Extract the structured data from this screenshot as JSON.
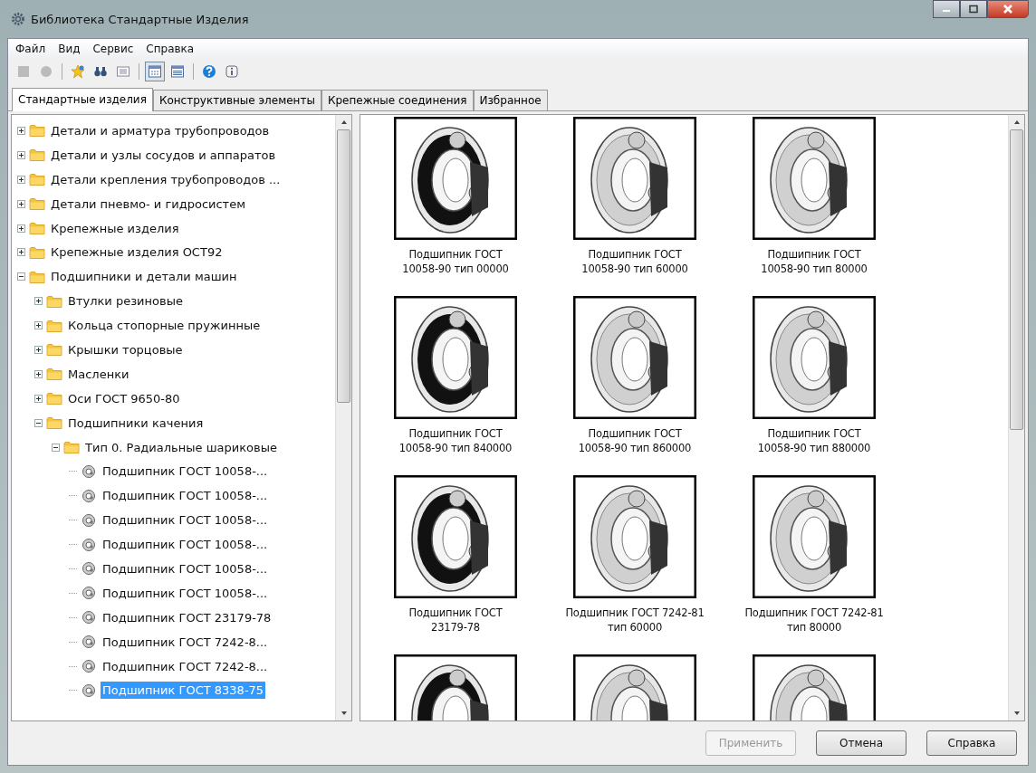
{
  "window": {
    "title": "Библиотека Стандартные Изделия"
  },
  "menu": [
    "Файл",
    "Вид",
    "Сервис",
    "Справка"
  ],
  "toolbar": [
    {
      "kind": "page",
      "disabled": true,
      "selected": false
    },
    {
      "kind": "circle",
      "disabled": true,
      "selected": false
    },
    {
      "kind": "star",
      "disabled": false,
      "selected": false
    },
    {
      "kind": "binoculars",
      "disabled": false,
      "selected": false
    },
    {
      "kind": "list",
      "disabled": false,
      "selected": false
    },
    {
      "kind": "grid",
      "disabled": false,
      "selected": true
    },
    {
      "kind": "table",
      "disabled": false,
      "selected": false
    },
    {
      "kind": "help",
      "disabled": false,
      "selected": false
    },
    {
      "kind": "info",
      "disabled": false,
      "selected": false
    }
  ],
  "tabs": [
    {
      "label": "Стандартные изделия",
      "selected": true
    },
    {
      "label": "Конструктивные элементы",
      "selected": false
    },
    {
      "label": "Крепежные соединения",
      "selected": false
    },
    {
      "label": "Избранное",
      "selected": false
    }
  ],
  "tree": [
    {
      "label": "Детали и арматура трубопроводов",
      "kind": "folder",
      "expanded": false,
      "selected": false
    },
    {
      "label": "Детали и узлы сосудов и аппаратов",
      "kind": "folder",
      "expanded": false,
      "selected": false
    },
    {
      "label": "Детали крепления трубопроводов ...",
      "kind": "folder",
      "expanded": false,
      "selected": false
    },
    {
      "label": "Детали пневмо- и гидросистем",
      "kind": "folder",
      "expanded": false,
      "selected": false
    },
    {
      "label": "Крепежные изделия",
      "kind": "folder",
      "expanded": false,
      "selected": false
    },
    {
      "label": "Крепежные изделия ОСТ92",
      "kind": "folder",
      "expanded": false,
      "selected": false
    },
    {
      "label": "Подшипники и детали машин",
      "kind": "folder",
      "expanded": true,
      "selected": false,
      "children": [
        {
          "label": "Втулки резиновые",
          "kind": "folder",
          "expanded": false,
          "selected": false
        },
        {
          "label": "Кольца стопорные пружинные",
          "kind": "folder",
          "expanded": false,
          "selected": false
        },
        {
          "label": "Крышки торцовые",
          "kind": "folder",
          "expanded": false,
          "selected": false
        },
        {
          "label": "Масленки",
          "kind": "folder",
          "expanded": false,
          "selected": false
        },
        {
          "label": "Оси ГОСТ 9650-80",
          "kind": "folder",
          "expanded": false,
          "selected": false
        },
        {
          "label": "Подшипники качения",
          "kind": "folder",
          "expanded": true,
          "selected": false,
          "children": [
            {
              "label": "Тип 0. Радиальные шариковые",
              "kind": "folder",
              "expanded": true,
              "selected": false,
              "children": [
                {
                  "label": "Подшипник ГОСТ 10058-...",
                  "kind": "item",
                  "selected": false
                },
                {
                  "label": "Подшипник ГОСТ 10058-...",
                  "kind": "item",
                  "selected": false
                },
                {
                  "label": "Подшипник ГОСТ 10058-...",
                  "kind": "item",
                  "selected": false
                },
                {
                  "label": "Подшипник ГОСТ 10058-...",
                  "kind": "item",
                  "selected": false
                },
                {
                  "label": "Подшипник ГОСТ 10058-...",
                  "kind": "item",
                  "selected": false
                },
                {
                  "label": "Подшипник ГОСТ 10058-...",
                  "kind": "item",
                  "selected": false
                },
                {
                  "label": "Подшипник ГОСТ 23179-78",
                  "kind": "item",
                  "selected": false
                },
                {
                  "label": "Подшипник ГОСТ 7242-8...",
                  "kind": "item",
                  "selected": false
                },
                {
                  "label": "Подшипник ГОСТ 7242-8...",
                  "kind": "item",
                  "selected": false
                },
                {
                  "label": "Подшипник ГОСТ 8338-75",
                  "kind": "item",
                  "selected": true
                }
              ]
            }
          ]
        }
      ]
    }
  ],
  "gallery": [
    {
      "caption": "Подшипник ГОСТ\n10058-90 тип 00000",
      "kind": "open"
    },
    {
      "caption": "Подшипник ГОСТ\n10058-90 тип 60000",
      "kind": "shielded"
    },
    {
      "caption": "Подшипник ГОСТ\n10058-90 тип 80000",
      "kind": "shielded"
    },
    {
      "caption": "Подшипник ГОСТ\n10058-90 тип 840000",
      "kind": "open"
    },
    {
      "caption": "Подшипник ГОСТ\n10058-90 тип 860000",
      "kind": "shielded"
    },
    {
      "caption": "Подшипник ГОСТ\n10058-90 тип 880000",
      "kind": "shielded"
    },
    {
      "caption": "Подшипник ГОСТ\n23179-78",
      "kind": "open"
    },
    {
      "caption": "Подшипник ГОСТ 7242-81\nтип 60000",
      "kind": "shielded"
    },
    {
      "caption": "Подшипник ГОСТ 7242-81\nтип 80000",
      "kind": "shielded"
    },
    {
      "kind": "open"
    },
    {
      "kind": "shielded"
    },
    {
      "kind": "shielded"
    }
  ],
  "buttons": [
    {
      "label": "Применить",
      "disabled": true
    },
    {
      "label": "Отмена",
      "disabled": false
    },
    {
      "label": "Справка",
      "disabled": false
    }
  ]
}
